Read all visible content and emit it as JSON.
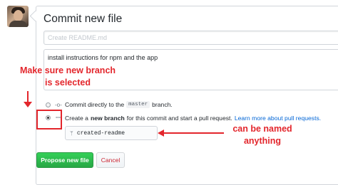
{
  "form": {
    "title": "Commit new file",
    "summary_placeholder": "Create README.md",
    "description_value": "install instructions for npm and the app"
  },
  "options": {
    "direct_prefix": "Commit directly to the",
    "direct_branch": "master",
    "direct_suffix": "branch.",
    "new_prefix": "Create a",
    "new_bold": "new branch",
    "new_suffix": "for this commit and start a pull request.",
    "new_link": "Learn more about pull requests.",
    "selected": "new_branch"
  },
  "branch": {
    "name": "created-readme",
    "icon": "branch-icon"
  },
  "buttons": {
    "propose": "Propose new file",
    "cancel": "Cancel"
  },
  "annotations": {
    "left_line1": "Make sure new branch",
    "left_line2": "is selected",
    "right_line1": "can be named",
    "right_line2": "anything",
    "color": "#e3262c"
  },
  "colors": {
    "primary_button": "#28a745",
    "link": "#0366d6",
    "cancel_text": "#cb2431"
  }
}
